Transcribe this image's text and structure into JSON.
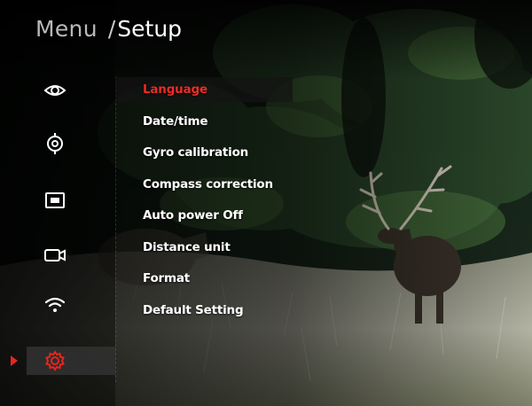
{
  "breadcrumb": {
    "root": "Menu",
    "separator": "/",
    "current": "Setup"
  },
  "sidebar": {
    "items": [
      {
        "icon": "eye-icon",
        "label": "Display"
      },
      {
        "icon": "reticle-icon",
        "label": "Reticle"
      },
      {
        "icon": "picture-in-picture-icon",
        "label": "PiP"
      },
      {
        "icon": "camera-icon",
        "label": "Recording"
      },
      {
        "icon": "wifi-icon",
        "label": "Wi-Fi"
      },
      {
        "icon": "gear-icon",
        "label": "Setup",
        "active": true
      }
    ]
  },
  "menu": {
    "selected_index": 0,
    "items": [
      {
        "label": "Language"
      },
      {
        "label": "Date/time"
      },
      {
        "label": "Gyro calibration"
      },
      {
        "label": "Compass correction"
      },
      {
        "label": "Auto power Off"
      },
      {
        "label": "Distance unit"
      },
      {
        "label": "Format"
      },
      {
        "label": "Default Setting"
      }
    ]
  },
  "colors": {
    "accent": "#e8261f",
    "text": "#ffffff",
    "muted": "#b9b9b9"
  }
}
